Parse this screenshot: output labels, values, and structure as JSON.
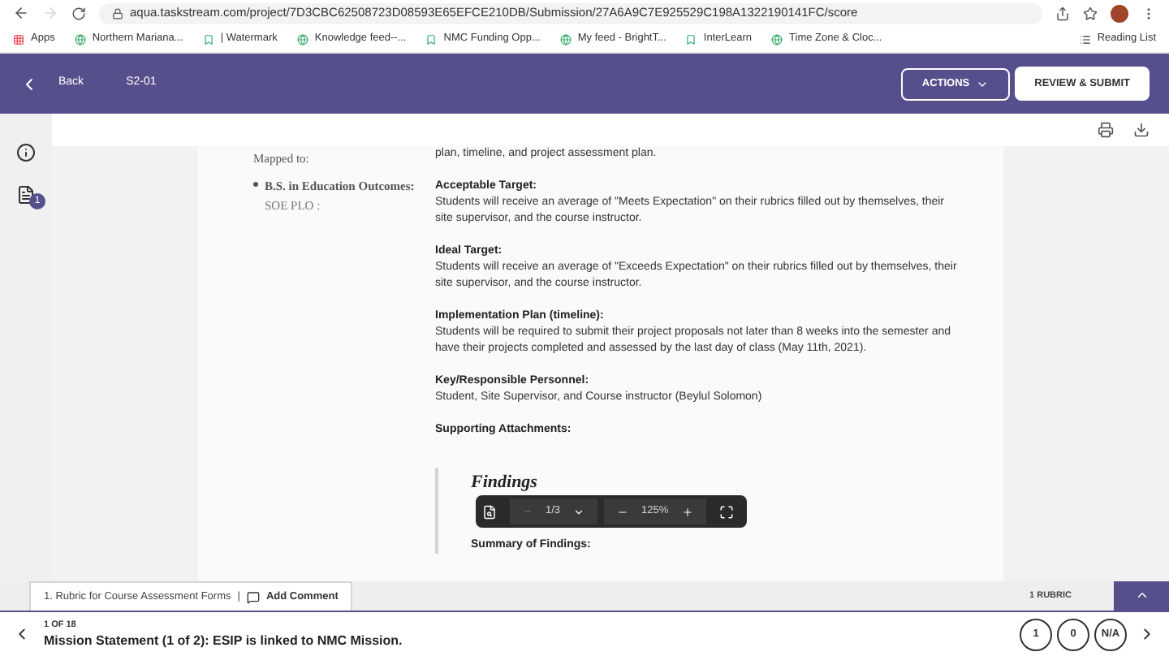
{
  "browser": {
    "url": "aqua.taskstream.com/project/7D3CBC62508723D08593E65EFCE210DB/Submission/27A6A9C7E925529C198A1322190141FC/score",
    "bookmarks": [
      "Apps",
      "Northern Mariana...",
      "| Watermark",
      "Knowledge feed--...",
      "NMC Funding Opp...",
      "My feed - BrightT...",
      "InterLearn",
      "Time Zone & Cloc..."
    ],
    "reading_list": "Reading List"
  },
  "header": {
    "back": "Back",
    "title": "S2-01",
    "actions": "ACTIONS",
    "submit": "REVIEW & SUBMIT"
  },
  "sidebar": {
    "attachments_badge": "1"
  },
  "document": {
    "mapped_to": "Mapped to:",
    "outcome": "B.S. in Education Outcomes:",
    "outcome_detail": "SOE PLO :",
    "intro": "plan, timeline, and project assessment plan.",
    "sections": [
      {
        "heading": "Acceptable Target:",
        "body": "Students will receive an average of \"Meets Expectation\" on their rubrics filled out by themselves, their site supervisor, and the course instructor."
      },
      {
        "heading": "Ideal Target:",
        "body": "Students will receive an average of \"Exceeds Expectation\" on their rubrics filled out by themselves, their site supervisor, and the course instructor."
      },
      {
        "heading": "Implementation Plan (timeline):",
        "body": "Students will be required to submit their project proposals not later than 8 weeks into the semester and have their projects completed and assessed by the last day of class (May 11th, 2021)."
      },
      {
        "heading": "Key/Responsible Personnel:",
        "body": "Student, Site Supervisor, and Course instructor (Beylul Solomon)"
      },
      {
        "heading": "Supporting Attachments:"
      }
    ],
    "findings_title": "Findings",
    "summary": "Summary of Findings:"
  },
  "pdf_toolbar": {
    "page": "1/3",
    "zoom": "125%"
  },
  "rubric_tab": {
    "label": "1. Rubric for Course Assessment Forms",
    "separator": "|",
    "comment": "Add Comment",
    "count": "1 RUBRIC"
  },
  "criterion": {
    "position": "1 OF 18",
    "title": "Mission Statement (1 of 2): ESIP is linked to NMC Mission.",
    "scores": [
      "1",
      "0",
      "N/A"
    ]
  }
}
